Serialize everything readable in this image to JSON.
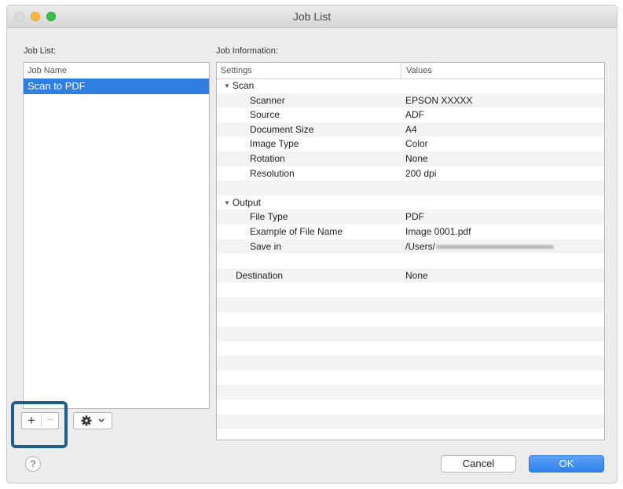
{
  "window": {
    "title": "Job List"
  },
  "job_list": {
    "label": "Job List:",
    "column_header": "Job Name",
    "items": [
      {
        "name": "Scan to PDF",
        "selected": true
      }
    ]
  },
  "job_info": {
    "label": "Job Information:",
    "columns": {
      "settings": "Settings",
      "values": "Values"
    },
    "groups": {
      "scan": {
        "title": "Scan",
        "rows": [
          {
            "key": "Scanner",
            "value": "EPSON XXXXX"
          },
          {
            "key": "Source",
            "value": "ADF"
          },
          {
            "key": "Document Size",
            "value": "A4"
          },
          {
            "key": "Image Type",
            "value": "Color"
          },
          {
            "key": "Rotation",
            "value": "None"
          },
          {
            "key": "Resolution",
            "value": "200 dpi"
          }
        ]
      },
      "output": {
        "title": "Output",
        "rows": [
          {
            "key": "File Type",
            "value": "PDF"
          },
          {
            "key": "Example of File Name",
            "value": "Image 0001.pdf"
          },
          {
            "key": "Save in",
            "value": "/Users/"
          }
        ]
      },
      "destination": {
        "key": "Destination",
        "value": "None"
      }
    }
  },
  "toolbar": {
    "add": "+",
    "remove": "−",
    "settings_menu": "gear-icon"
  },
  "buttons": {
    "help": "?",
    "cancel": "Cancel",
    "ok": "OK"
  },
  "colors": {
    "selection": "#2f7fe0",
    "ok_button": "#3e8ff0",
    "highlight_border": "#1f5d8c"
  }
}
